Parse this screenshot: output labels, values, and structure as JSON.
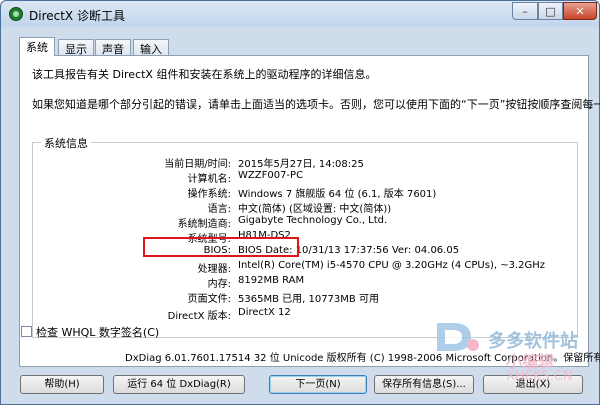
{
  "window": {
    "title": "DirectX 诊断工具",
    "controls": {
      "minimize": "–",
      "maximize": "□",
      "close": "✕"
    }
  },
  "tabs": [
    {
      "label": "系统",
      "active": true
    },
    {
      "label": "显示",
      "active": false
    },
    {
      "label": "声音",
      "active": false
    },
    {
      "label": "输入",
      "active": false
    }
  ],
  "intro": {
    "line1": "该工具报告有关 DirectX 组件和安装在系统上的驱动程序的详细信息。",
    "line2": "如果您知道是哪个部分引起的错误，请单击上面适当的选项卡。否则，您可以使用下面的“下一页”按钮按顺序查阅每一页。"
  },
  "system_info": {
    "group_title": "系统信息",
    "rows": [
      {
        "label": "当前日期/时间:",
        "value": "2015年5月27日, 14:08:25"
      },
      {
        "label": "计算机名:",
        "value": "WZZF007-PC"
      },
      {
        "label": "操作系统:",
        "value": "Windows 7 旗舰版 64 位 (6.1, 版本 7601)"
      },
      {
        "label": "语言:",
        "value": "中文(简体) (区域设置: 中文(简体))"
      },
      {
        "label": "系统制造商:",
        "value": "Gigabyte Technology Co., Ltd."
      },
      {
        "label": "系统型号:",
        "value": "H81M-DS2"
      },
      {
        "label": "BIOS:",
        "value": "BIOS Date: 10/31/13 17:37:56 Ver: 04.06.05"
      },
      {
        "label": "处理器:",
        "value": "Intel(R) Core(TM) i5-4570 CPU @ 3.20GHz (4 CPUs), ~3.2GHz"
      },
      {
        "label": "内存:",
        "value": "8192MB RAM"
      },
      {
        "label": "页面文件:",
        "value": "5365MB 已用, 10773MB 可用"
      },
      {
        "label": "DirectX 版本:",
        "value": "DirectX 12"
      }
    ]
  },
  "whql_checkbox": {
    "label": "检查 WHQL 数字签名(C)",
    "checked": false
  },
  "footer": "DxDiag 6.01.7601.17514 32 位 Unicode 版权所有 (C) 1998-2006 Microsoft Corporation。保留所有权",
  "buttons": {
    "help": "帮助(H)",
    "run64": "运行 64 位 DxDiag(R)",
    "next": "下一页(N)",
    "save": "保存所有信息(S)...",
    "exit": "退出(X)"
  },
  "watermark": {
    "line1": "多多软件站",
    "line2": "小编辑",
    "line3": "XHEKS.CN"
  },
  "colors": {
    "highlight_border": "#e0141a",
    "window_frame": "#cfdcec"
  }
}
